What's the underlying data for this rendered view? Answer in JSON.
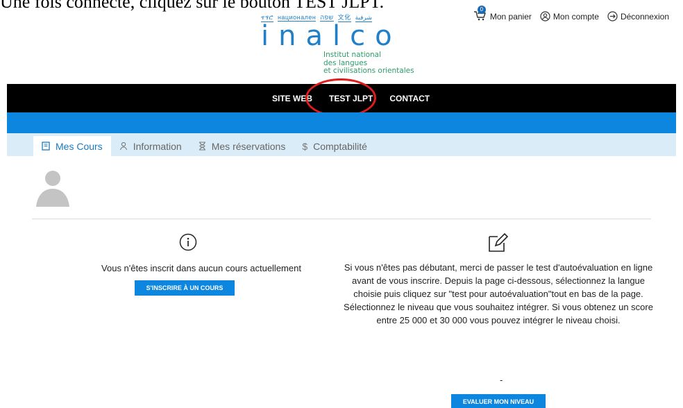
{
  "instruction": "Une fois connecté, cliquez sur le bouton TEST JLPT.",
  "logo": {
    "scripts": [
      "ተፃሮ",
      "национален",
      "שפה",
      "文化",
      "شرفية"
    ],
    "word": "inalco",
    "subtitle_lines": [
      "Institut national",
      "des langues",
      "et civilisations orientales"
    ]
  },
  "top_links": {
    "cart": "Mon panier",
    "cart_count": "0",
    "account": "Mon compte",
    "logout": "Déconnexion"
  },
  "nav": {
    "items": [
      "SITE WEB",
      "TEST JLPT",
      "CONTACT"
    ],
    "highlighted": "TEST JLPT",
    "highlight_color": "#e01c1c"
  },
  "tabs": [
    {
      "label": "Mes Cours",
      "icon": "book-icon",
      "active": true
    },
    {
      "label": "Information",
      "icon": "user-icon",
      "active": false
    },
    {
      "label": "Mes réservations",
      "icon": "hourglass-icon",
      "active": false
    },
    {
      "label": "Comptabilité",
      "icon": "dollar-icon",
      "active": false
    }
  ],
  "left_column": {
    "message": "Vous n'êtes inscrit dans aucun cours actuellement",
    "button": "S'INSCRIRE À UN COURS"
  },
  "right_column": {
    "message": "Si vous n'êtes pas débutant, merci de passer le test d'autoévaluation en ligne avant de vous inscrire. Depuis la page ci-dessous, sélectionnez la langue choisie puis cliquez sur \"test pour autoévaluation\"tout en bas de la page. Sélectionnez le niveau que vous souhaitez intégrer. Si vous obtenez un score entre 25 000 et 30 000 vous pouvez intégrer le niveau choisi.",
    "dash": "-",
    "button": "EVALUER MON NIVEAU"
  },
  "colors": {
    "brand_blue": "#0d86e0",
    "nav_black": "#000000",
    "tab_bg": "#d9ecf7",
    "logo_blue": "#1f7fc8",
    "logo_green": "#2d9a6a"
  }
}
